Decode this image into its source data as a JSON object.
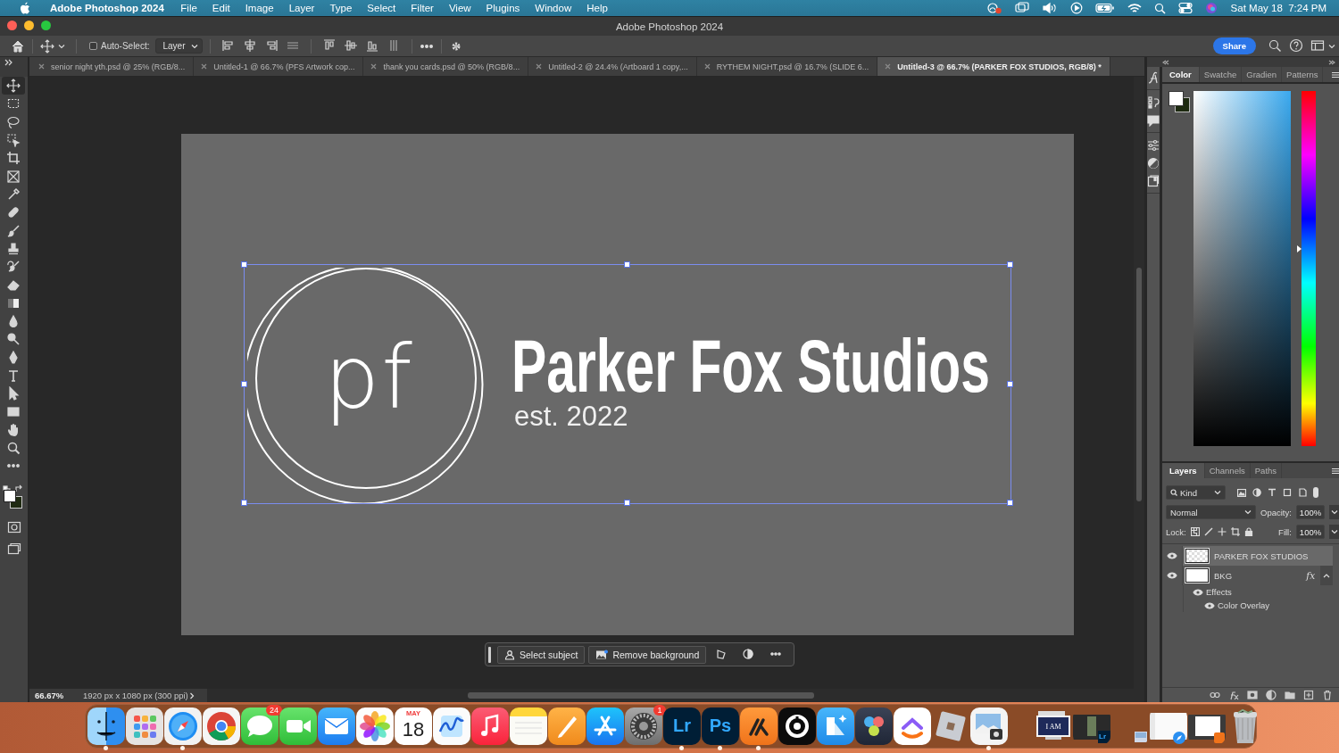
{
  "menubar": {
    "app": "Adobe Photoshop 2024",
    "menus": [
      "File",
      "Edit",
      "Image",
      "Layer",
      "Type",
      "Select",
      "Filter",
      "View",
      "Plugins",
      "Window",
      "Help"
    ],
    "clock": "Sat May 18  7:24 PM"
  },
  "window": {
    "title": "Adobe Photoshop 2024"
  },
  "options_bar": {
    "auto_select": {
      "label": "Auto-Select:",
      "checked": false
    },
    "target": "Layer",
    "share": "Share"
  },
  "tabs": [
    {
      "label": "senior night yth.psd @ 25% (RGB/8...",
      "selected": false
    },
    {
      "label": "Untitled-1 @ 66.7% (PFS Artwork cop...",
      "selected": false
    },
    {
      "label": "thank you cards.psd @ 50% (RGB/8...",
      "selected": false
    },
    {
      "label": "Untitled-2 @ 24.4% (Artboard 1 copy,...",
      "selected": false
    },
    {
      "label": "RYTHEM NIGHT.psd @ 16.7% (SLIDE 6...",
      "selected": false
    },
    {
      "label": "Untitled-3 @ 66.7% (PARKER FOX STUDIOS, RGB/8) *",
      "selected": true
    }
  ],
  "toolbar": {
    "tools": [
      {
        "kind": "move",
        "selected": true
      },
      {
        "kind": "marquee",
        "selected": false
      },
      {
        "kind": "lasso",
        "selected": false
      },
      {
        "kind": "object-select",
        "selected": false
      },
      {
        "kind": "crop",
        "selected": false
      },
      {
        "kind": "frame",
        "selected": false
      },
      {
        "kind": "eyedropper",
        "selected": false
      },
      {
        "kind": "healing",
        "selected": false
      },
      {
        "kind": "brush",
        "selected": false
      },
      {
        "kind": "stamp",
        "selected": false
      },
      {
        "kind": "history-brush",
        "selected": false
      },
      {
        "kind": "eraser",
        "selected": false
      },
      {
        "kind": "gradient",
        "selected": false
      },
      {
        "kind": "blur",
        "selected": false
      },
      {
        "kind": "dodge",
        "selected": false
      },
      {
        "kind": "pen",
        "selected": false
      },
      {
        "kind": "type",
        "selected": false
      },
      {
        "kind": "path-select",
        "selected": false
      },
      {
        "kind": "rectangle",
        "selected": false
      },
      {
        "kind": "hand",
        "selected": false
      },
      {
        "kind": "zoom",
        "selected": false
      },
      {
        "kind": "more",
        "selected": false
      }
    ]
  },
  "canvas": {
    "monogram": "pf",
    "headline": "Parker Fox Studios",
    "tagline": "est. 2022"
  },
  "contextual_bar": {
    "buttons": [
      "Select subject",
      "Remove background"
    ]
  },
  "status_bar": {
    "zoom": "66.67%",
    "info": "1920 px x 1080 px (300 ppi)"
  },
  "color_panel": {
    "tabs": [
      {
        "label": "Color",
        "selected": true
      },
      {
        "label": "Swatche",
        "selected": false
      },
      {
        "label": "Gradien",
        "selected": false
      },
      {
        "label": "Patterns",
        "selected": false
      }
    ],
    "hue_slider": {
      "level": 0.555
    }
  },
  "layers_panel": {
    "tabs": [
      {
        "label": "Layers",
        "selected": true
      },
      {
        "label": "Channels",
        "selected": false
      },
      {
        "label": "Paths",
        "selected": false
      }
    ],
    "filter": "Kind",
    "blend_mode": "Normal",
    "opacity_label": "Opacity:",
    "opacity": "100%",
    "lock_label": "Lock:",
    "fill_label": "Fill:",
    "fill": "100%",
    "layers": [
      {
        "name": "PARKER FOX STUDIOS",
        "kind": "transparent",
        "selected": true,
        "visible": true
      },
      {
        "name": "BKG",
        "kind": "fill",
        "selected": false,
        "visible": true,
        "fx": "fx",
        "expanded": true,
        "effects": [
          {
            "name": "Effects",
            "visible": true,
            "children": [
              {
                "name": "Color Overlay",
                "visible": true
              }
            ]
          }
        ]
      }
    ]
  },
  "dock": {
    "apps": [
      {
        "kind": "finder",
        "running": true
      },
      {
        "kind": "launchpad",
        "running": false
      },
      {
        "kind": "safari",
        "running": true
      },
      {
        "kind": "chrome",
        "running": false
      },
      {
        "kind": "messages",
        "running": false,
        "badge": "24"
      },
      {
        "kind": "facetime",
        "running": false
      },
      {
        "kind": "mail",
        "running": false
      },
      {
        "kind": "photos",
        "running": false
      },
      {
        "kind": "calendar",
        "running": false,
        "month": "MAY",
        "day": "18"
      },
      {
        "kind": "freeform",
        "running": false
      },
      {
        "kind": "music",
        "running": false
      },
      {
        "kind": "notes",
        "running": false
      },
      {
        "kind": "pages",
        "running": false
      },
      {
        "kind": "appstore",
        "running": false
      },
      {
        "kind": "settings",
        "running": false,
        "badge": "1"
      },
      {
        "kind": "lightroom",
        "running": true,
        "label": "Lr"
      },
      {
        "kind": "photoshop",
        "running": true,
        "label": "Ps"
      },
      {
        "kind": "orange-app",
        "running": true
      },
      {
        "kind": "ring-app",
        "running": false
      },
      {
        "kind": "blue-app",
        "running": false
      },
      {
        "kind": "davinci",
        "running": false
      },
      {
        "kind": "clickup",
        "running": false
      },
      {
        "kind": "roblox",
        "running": false
      },
      {
        "kind": "preview",
        "running": true
      }
    ],
    "windows": [
      {
        "kind": "slide-window",
        "label": "I AM"
      },
      {
        "kind": "lr-window",
        "label": "Lr"
      },
      {
        "kind": "small-window"
      },
      {
        "kind": "safari-window"
      },
      {
        "kind": "orange-window"
      },
      {
        "kind": "trash"
      }
    ]
  }
}
